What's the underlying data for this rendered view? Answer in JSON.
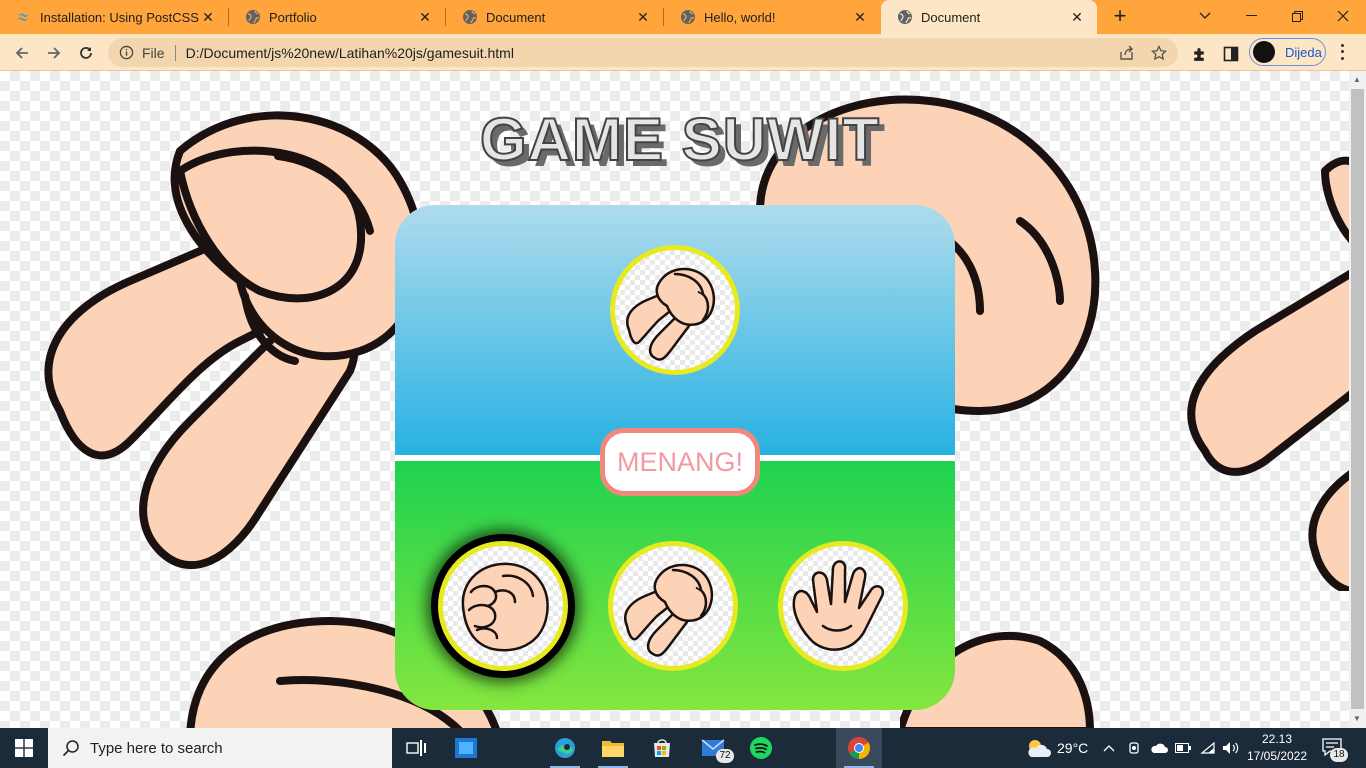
{
  "browser": {
    "tabs": [
      {
        "title": "Installation: Using PostCSS -",
        "icon": "tailwind-icon",
        "active": false
      },
      {
        "title": "Portfolio",
        "icon": "globe-icon",
        "active": false
      },
      {
        "title": "Document",
        "icon": "globe-icon",
        "active": false
      },
      {
        "title": "Hello, world!",
        "icon": "globe-icon",
        "active": false
      },
      {
        "title": "Document",
        "icon": "globe-icon",
        "active": true
      }
    ],
    "address": {
      "scheme_label": "File",
      "url": "D:/Document/js%20new/Latihan%20js/gamesuit.html"
    },
    "profile_name": "Dijeda",
    "accent_color": "#ffa53c"
  },
  "game": {
    "title": "GAME SUWIT",
    "computer_choice": "scissors",
    "result_text": "MENANG!",
    "player_choices": [
      {
        "name": "rock",
        "selected": true
      },
      {
        "name": "scissors",
        "selected": false
      },
      {
        "name": "paper",
        "selected": false
      }
    ]
  },
  "taskbar": {
    "search_placeholder": "Type here to search",
    "mail_badge": "72",
    "weather": "29°C",
    "time": "22.13",
    "date": "17/05/2022",
    "notification_count": "18"
  }
}
